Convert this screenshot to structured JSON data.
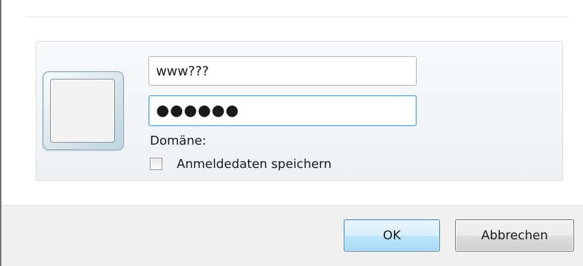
{
  "credential": {
    "username_value": "www???",
    "password_masked": "●●●●●●",
    "domain_label": "Domäne:",
    "remember_label": "Anmeldedaten speichern",
    "remember_checked": false
  },
  "buttons": {
    "ok_label": "OK",
    "cancel_label": "Abbrechen"
  },
  "colors": {
    "focus_border": "#4c9fcf",
    "default_button_border": "#3c7fb1",
    "footer_background": "#f0f0f0"
  }
}
